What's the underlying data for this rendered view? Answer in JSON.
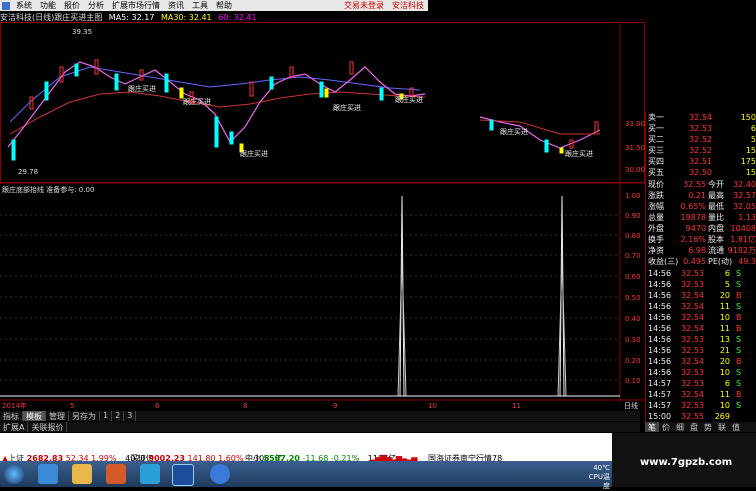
{
  "menubar": {
    "items": [
      "系统",
      "功能",
      "报价",
      "分析",
      "扩展市场行情",
      "资讯",
      "工具",
      "帮助"
    ],
    "right_items": [
      "交易未登录",
      "安洁科技"
    ]
  },
  "chart_title": {
    "text": "安洁科技(日线)跟庄买进主图",
    "ma5": "MA5: 32.17",
    "ma30": "MA30: 32.41",
    "ma60": "60: 32.41"
  },
  "price_chart": {
    "high_label": "39.35",
    "low_label": "29.78",
    "signal_label": "跟庄买进",
    "y_ticks": [
      "33.00",
      "31.50",
      "30.00"
    ]
  },
  "indicator": {
    "title": "跟庄底部抬线 准备参与: 0.00",
    "y_ticks": [
      "1.00",
      "0.90",
      "0.80",
      "0.70",
      "0.60",
      "0.50",
      "0.40",
      "0.30",
      "0.20",
      "0.10"
    ]
  },
  "x_axis": {
    "labels": [
      "2014年",
      "5",
      "6",
      "8",
      "9",
      "10",
      "11"
    ],
    "right_label": "日线"
  },
  "chart_data": {
    "type": "line",
    "title": "跟庄底部抬线 准备参与: 0.00",
    "xlabel": "",
    "ylabel": "",
    "ylim": [
      0,
      1
    ],
    "series": [
      {
        "name": "跟庄底部抬线",
        "spikes_at_month": [
          "10",
          "11"
        ],
        "values": [
          0,
          0,
          1,
          0,
          0,
          1,
          0
        ]
      }
    ]
  },
  "quote": {
    "asks": [
      {
        "label": "卖一",
        "price": "32.54",
        "vol": "150"
      },
      {
        "label": "买一",
        "price": "32.53",
        "vol": "6"
      },
      {
        "label": "买二",
        "price": "32.52",
        "vol": "5"
      },
      {
        "label": "买三",
        "price": "32.52",
        "vol": "15"
      },
      {
        "label": "买四",
        "price": "32.51",
        "vol": "175"
      },
      {
        "label": "买五",
        "price": "32.50",
        "vol": "15"
      }
    ],
    "stats": [
      {
        "l1": "现价",
        "v1": "32.55",
        "l2": "今开",
        "v2": "32.40"
      },
      {
        "l1": "涨跌",
        "v1": "0.21",
        "l2": "最高",
        "v2": "32.57"
      },
      {
        "l1": "涨幅",
        "v1": "0.65%",
        "l2": "最低",
        "v2": "32.05"
      },
      {
        "l1": "总量",
        "v1": "19878",
        "l2": "量比",
        "v2": "1.13"
      },
      {
        "l1": "外盘",
        "v1": "9470",
        "l2": "内盘",
        "v2": "10408"
      },
      {
        "l1": "换手",
        "v1": "2.16%",
        "l2": "股本",
        "v2": "1.81亿"
      },
      {
        "l1": "净资",
        "v1": "6.98",
        "l2": "流通",
        "v2": "9182万"
      },
      {
        "l1": "收益(三)",
        "v1": "0.495",
        "l2": "PE(动)",
        "v2": "49.3"
      }
    ],
    "ticks": [
      {
        "time": "14:56",
        "price": "32.53",
        "vol": "6",
        "bs": "S"
      },
      {
        "time": "14:56",
        "price": "32.53",
        "vol": "5",
        "bs": "S"
      },
      {
        "time": "14:56",
        "price": "32.54",
        "vol": "20",
        "bs": "B"
      },
      {
        "time": "14:56",
        "price": "32.54",
        "vol": "11",
        "bs": "S"
      },
      {
        "time": "14:56",
        "price": "32.54",
        "vol": "10",
        "bs": "B"
      },
      {
        "time": "14:56",
        "price": "32.54",
        "vol": "11",
        "bs": "B"
      },
      {
        "time": "14:56",
        "price": "32.53",
        "vol": "13",
        "bs": "S"
      },
      {
        "time": "14:56",
        "price": "32.53",
        "vol": "21",
        "bs": "S"
      },
      {
        "time": "14:56",
        "price": "32.54",
        "vol": "20",
        "bs": "B"
      },
      {
        "time": "14:56",
        "price": "32.53",
        "vol": "10",
        "bs": "S"
      },
      {
        "time": "14:57",
        "price": "32.53",
        "vol": "6",
        "bs": "S"
      },
      {
        "time": "14:57",
        "price": "32.54",
        "vol": "11",
        "bs": "B"
      },
      {
        "time": "14:57",
        "price": "32.53",
        "vol": "10",
        "bs": "S"
      },
      {
        "time": "15:00",
        "price": "32.55",
        "vol": "269",
        "bs": ""
      }
    ]
  },
  "bottom_tabs": {
    "row1": [
      "指标",
      "模板",
      "管理",
      "另存为",
      "1",
      "2",
      "3"
    ],
    "row2": [
      "扩展A",
      "关联报价"
    ],
    "right": [
      "笔",
      "价",
      "细",
      "盘",
      "势",
      "联",
      "值"
    ]
  },
  "status": {
    "sh_label": "上证",
    "sh_value": "2682.83",
    "sh_change": "52.34",
    "sh_pct": "1.99%",
    "sh_amount": "4020亿",
    "sz_label": "深证",
    "sz_value": "9002.23",
    "sz_change": "141.80",
    "sz_pct": "1.60%",
    "sz_amount": "3085亿",
    "zx_label": "中小",
    "zx_value": "5587.20",
    "zx_change": "-11.68",
    "zx_pct": "-0.21%",
    "zx_amount": "1107亿",
    "broker": "国海证券南宁行情78"
  },
  "taskbar": {
    "temp": "40℃",
    "cpu": "CPU温度"
  },
  "watermark": "www.7gpzb.com",
  "colors": {
    "up": "#ff3333",
    "down": "#00ffff",
    "bg": "#000000",
    "grid": "#800000"
  }
}
